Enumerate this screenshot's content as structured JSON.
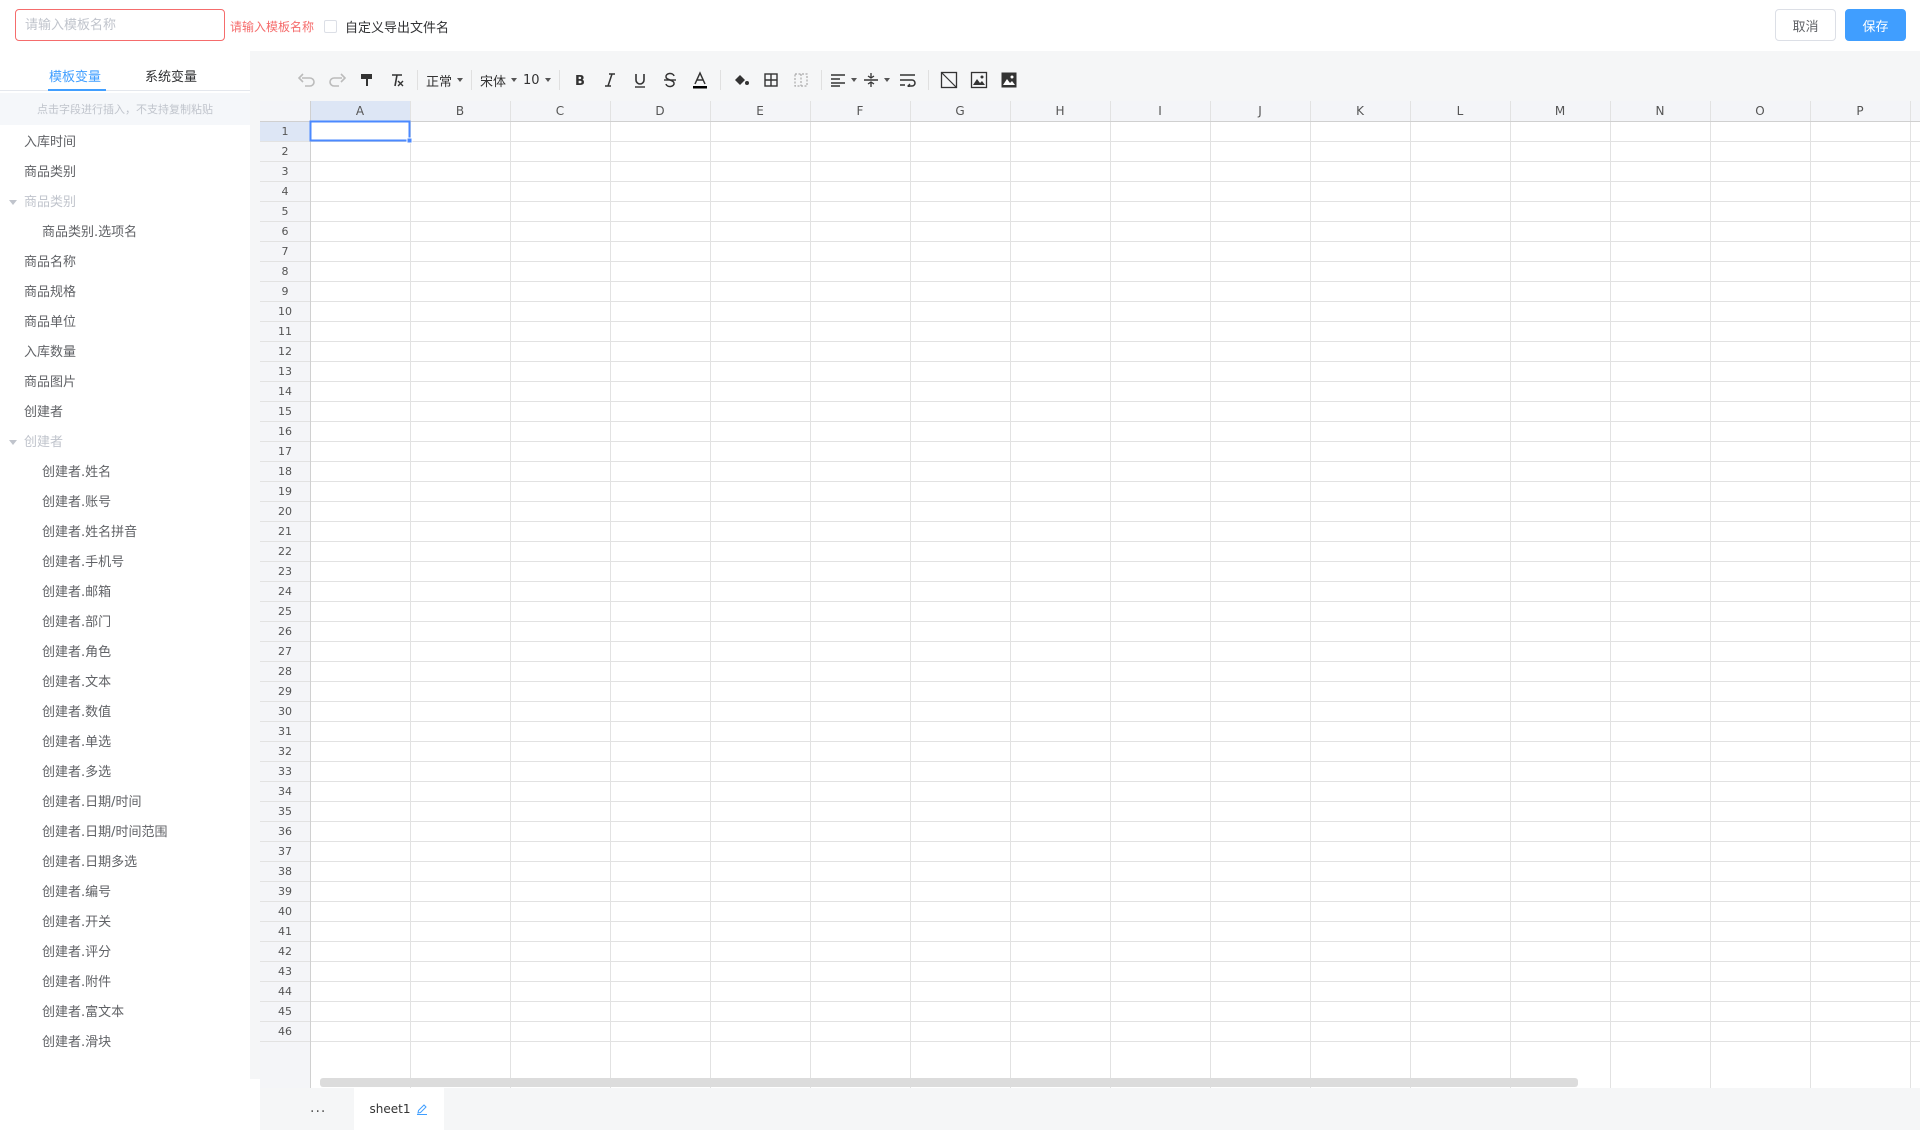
{
  "header": {
    "name_placeholder": "请输入模板名称",
    "name_error": "请输入模板名称",
    "custom_filename_label": "自定义导出文件名",
    "cancel_label": "取消",
    "save_label": "保存"
  },
  "sidebar": {
    "tabs": [
      {
        "label": "模板变量",
        "active": true
      },
      {
        "label": "系统变量",
        "active": false
      }
    ],
    "hint": "点击字段进行插入，不支持复制粘贴",
    "fields": [
      {
        "label": "入库时间",
        "level": 0
      },
      {
        "label": "商品类别",
        "level": 0
      },
      {
        "label": "商品类别",
        "level": "group"
      },
      {
        "label": "商品类别.选项名",
        "level": 1
      },
      {
        "label": "商品名称",
        "level": 0
      },
      {
        "label": "商品规格",
        "level": 0
      },
      {
        "label": "商品单位",
        "level": 0
      },
      {
        "label": "入库数量",
        "level": 0
      },
      {
        "label": "商品图片",
        "level": 0
      },
      {
        "label": "创建者",
        "level": 0
      },
      {
        "label": "创建者",
        "level": "group"
      },
      {
        "label": "创建者.姓名",
        "level": 1
      },
      {
        "label": "创建者.账号",
        "level": 1
      },
      {
        "label": "创建者.姓名拼音",
        "level": 1
      },
      {
        "label": "创建者.手机号",
        "level": 1
      },
      {
        "label": "创建者.邮箱",
        "level": 1
      },
      {
        "label": "创建者.部门",
        "level": 1
      },
      {
        "label": "创建者.角色",
        "level": 1
      },
      {
        "label": "创建者.文本",
        "level": 1
      },
      {
        "label": "创建者.数值",
        "level": 1
      },
      {
        "label": "创建者.单选",
        "level": 1
      },
      {
        "label": "创建者.多选",
        "level": 1
      },
      {
        "label": "创建者.日期/时间",
        "level": 1
      },
      {
        "label": "创建者.日期/时间范围",
        "level": 1
      },
      {
        "label": "创建者.日期多选",
        "level": 1
      },
      {
        "label": "创建者.编号",
        "level": 1
      },
      {
        "label": "创建者.开关",
        "level": 1
      },
      {
        "label": "创建者.评分",
        "level": 1
      },
      {
        "label": "创建者.附件",
        "level": 1
      },
      {
        "label": "创建者.富文本",
        "level": 1
      },
      {
        "label": "创建者.滑块",
        "level": 1
      }
    ]
  },
  "toolbar": {
    "format_label": "正常",
    "font_label": "宋体",
    "size_label": "10",
    "icons": [
      "undo-icon",
      "redo-icon",
      "paint-format-icon",
      "clear-format-icon",
      "bold-icon",
      "italic-icon",
      "underline-icon",
      "strike-icon",
      "font-color-icon",
      "fill-color-icon",
      "border-icon",
      "merge-icon",
      "align-icon",
      "valign-icon",
      "wrap-icon",
      "diagonal-icon",
      "float-image-icon",
      "cell-image-icon"
    ]
  },
  "grid": {
    "columns": [
      "A",
      "B",
      "C",
      "D",
      "E",
      "F",
      "G",
      "H",
      "I",
      "J",
      "K",
      "L",
      "M",
      "N",
      "O",
      "P"
    ],
    "rows": [
      "1",
      "2",
      "3",
      "4",
      "5",
      "6",
      "7",
      "8",
      "9",
      "10",
      "11",
      "12",
      "13",
      "14",
      "15",
      "16",
      "17",
      "18",
      "19",
      "20",
      "21",
      "22",
      "23",
      "24",
      "25",
      "26",
      "27",
      "28",
      "29",
      "30",
      "31",
      "32",
      "33",
      "34",
      "35",
      "36",
      "37",
      "38",
      "39",
      "40",
      "41",
      "42",
      "43",
      "44",
      "45",
      "46"
    ],
    "selected_cell": "A1",
    "selection_color": "#4b89ff"
  },
  "footer": {
    "more_label": "...",
    "sheet_name": "sheet1"
  }
}
